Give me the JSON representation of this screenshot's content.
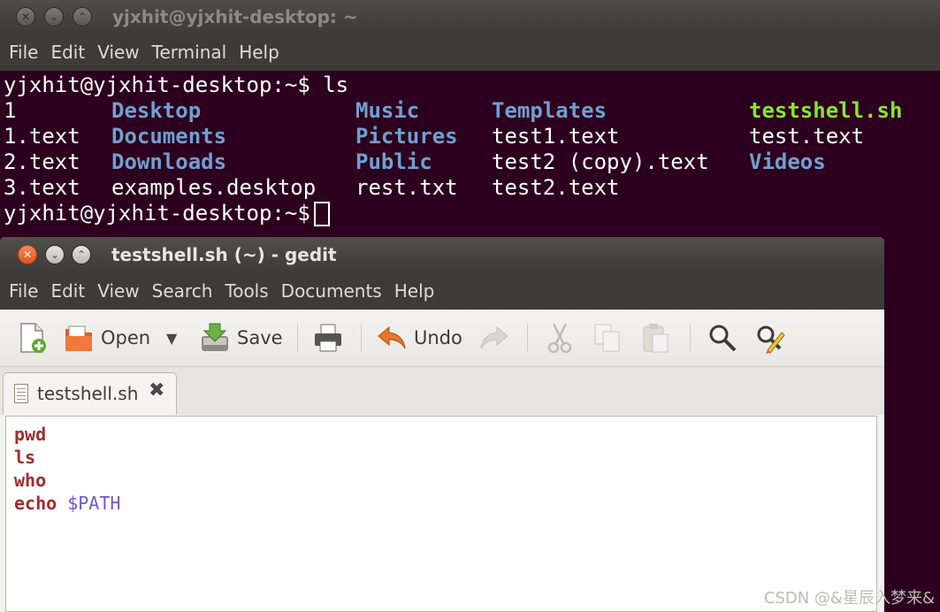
{
  "terminal": {
    "title": "yjxhit@yjxhit-desktop: ~",
    "menu": [
      "File",
      "Edit",
      "View",
      "Terminal",
      "Help"
    ],
    "prompt": "yjxhit@yjxhit-desktop:~$",
    "command": " ls",
    "listing": {
      "col1": [
        "1",
        "1.text",
        "2.text",
        "3.text"
      ],
      "col2": [
        "Desktop",
        "Documents",
        "Downloads",
        "examples.desktop"
      ],
      "col3": [
        "Music",
        "Pictures",
        "Public",
        "rest.txt"
      ],
      "col4": [
        "Templates",
        "test1.text",
        "test2 (copy).text",
        "test2.text"
      ],
      "col5": [
        "testshell.sh",
        "test.text",
        "Videos"
      ]
    },
    "colors": {
      "background": "#2c001e",
      "directory": "#729fcf",
      "executable": "#8ae234"
    }
  },
  "gedit": {
    "title": "testshell.sh (~) - gedit",
    "menu": [
      "File",
      "Edit",
      "View",
      "Search",
      "Tools",
      "Documents",
      "Help"
    ],
    "toolbar": {
      "open_label": "Open",
      "save_label": "Save",
      "undo_label": "Undo"
    },
    "tab_label": "testshell.sh",
    "code": {
      "line1": "pwd",
      "line2": "ls",
      "line3": "who",
      "line4_cmd": "echo",
      "line4_arg": " $PATH"
    }
  },
  "watermark": "CSDN @&星辰入梦来&"
}
